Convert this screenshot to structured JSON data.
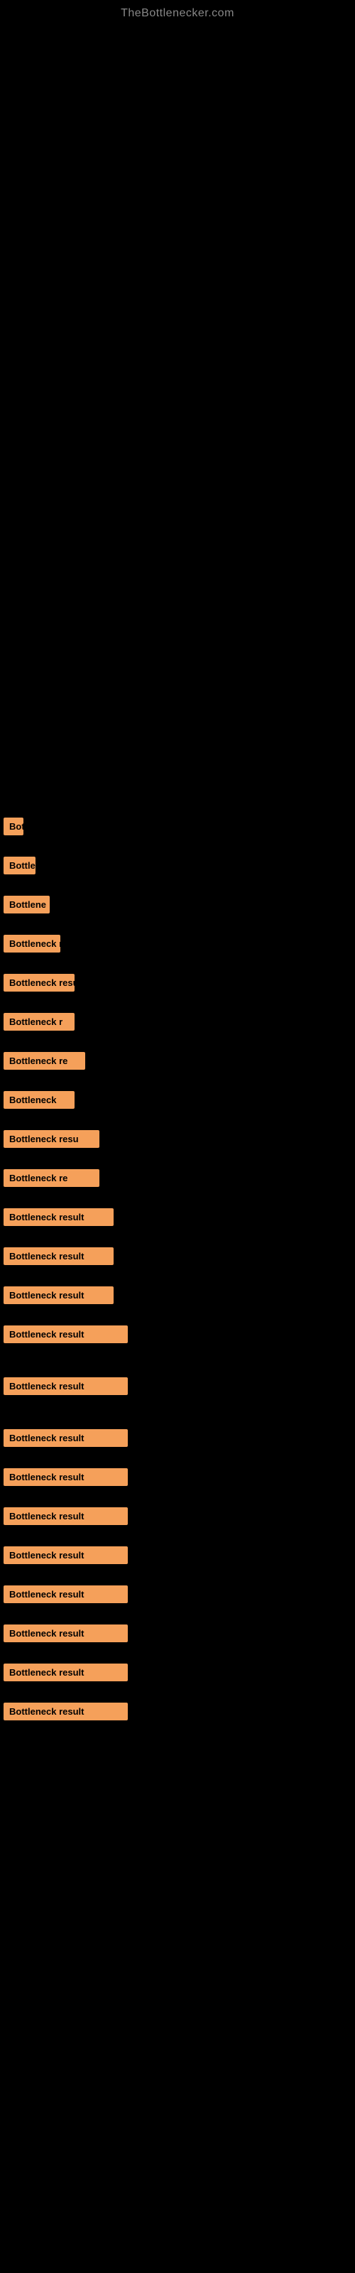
{
  "site": {
    "title": "TheBottlenecker.com"
  },
  "bottleneck_items": [
    {
      "id": 1,
      "label": "Bottl",
      "bar_class": "bar-tiny",
      "top_gap": 1100
    },
    {
      "id": 2,
      "label": "Bottleneck",
      "bar_class": "bar-xsmall",
      "top_gap": 1180
    },
    {
      "id": 3,
      "label": "Bottlene",
      "bar_class": "bar-small",
      "top_gap": 1250
    },
    {
      "id": 4,
      "label": "Bottleneck r",
      "bar_class": "bar-small-med",
      "top_gap": 1330
    },
    {
      "id": 5,
      "label": "Bottleneck resu",
      "bar_class": "bar-med",
      "top_gap": 1420
    },
    {
      "id": 6,
      "label": "Bottleneck r",
      "bar_class": "bar-med",
      "top_gap": 1510
    },
    {
      "id": 7,
      "label": "Bottleneck re",
      "bar_class": "bar-med-large",
      "top_gap": 1590
    },
    {
      "id": 8,
      "label": "Bottleneck",
      "bar_class": "bar-med",
      "top_gap": 1680
    },
    {
      "id": 9,
      "label": "Bottleneck resu",
      "bar_class": "bar-large",
      "top_gap": 1760
    },
    {
      "id": 10,
      "label": "Bottleneck re",
      "bar_class": "bar-large",
      "top_gap": 1850
    },
    {
      "id": 11,
      "label": "Bottleneck result",
      "bar_class": "bar-xlarge",
      "top_gap": 1940
    },
    {
      "id": 12,
      "label": "Bottleneck result",
      "bar_class": "bar-xlarge",
      "top_gap": 2030
    },
    {
      "id": 13,
      "label": "Bottleneck result",
      "bar_class": "bar-xlarge",
      "top_gap": 2120
    },
    {
      "id": 14,
      "label": "Bottleneck result",
      "bar_class": "bar-full",
      "top_gap": 2210
    },
    {
      "id": 15,
      "label": "Bottleneck result",
      "bar_class": "bar-full",
      "top_gap": 2354
    },
    {
      "id": 16,
      "label": "Bottleneck result",
      "bar_class": "bar-full",
      "top_gap": 2530
    },
    {
      "id": 17,
      "label": "Bottleneck result",
      "bar_class": "bar-full",
      "top_gap": 2620
    },
    {
      "id": 18,
      "label": "Bottleneck result",
      "bar_class": "bar-full",
      "top_gap": 2706
    },
    {
      "id": 19,
      "label": "Bottleneck result",
      "bar_class": "bar-full",
      "top_gap": 2796
    },
    {
      "id": 20,
      "label": "Bottleneck result",
      "bar_class": "bar-full",
      "top_gap": 2882
    },
    {
      "id": 21,
      "label": "Bottleneck result",
      "bar_class": "bar-full",
      "top_gap": 2972
    },
    {
      "id": 22,
      "label": "Bottleneck result",
      "bar_class": "bar-full",
      "top_gap": 3059
    },
    {
      "id": 23,
      "label": "Bottleneck result",
      "bar_class": "bar-full",
      "top_gap": 3147
    }
  ]
}
